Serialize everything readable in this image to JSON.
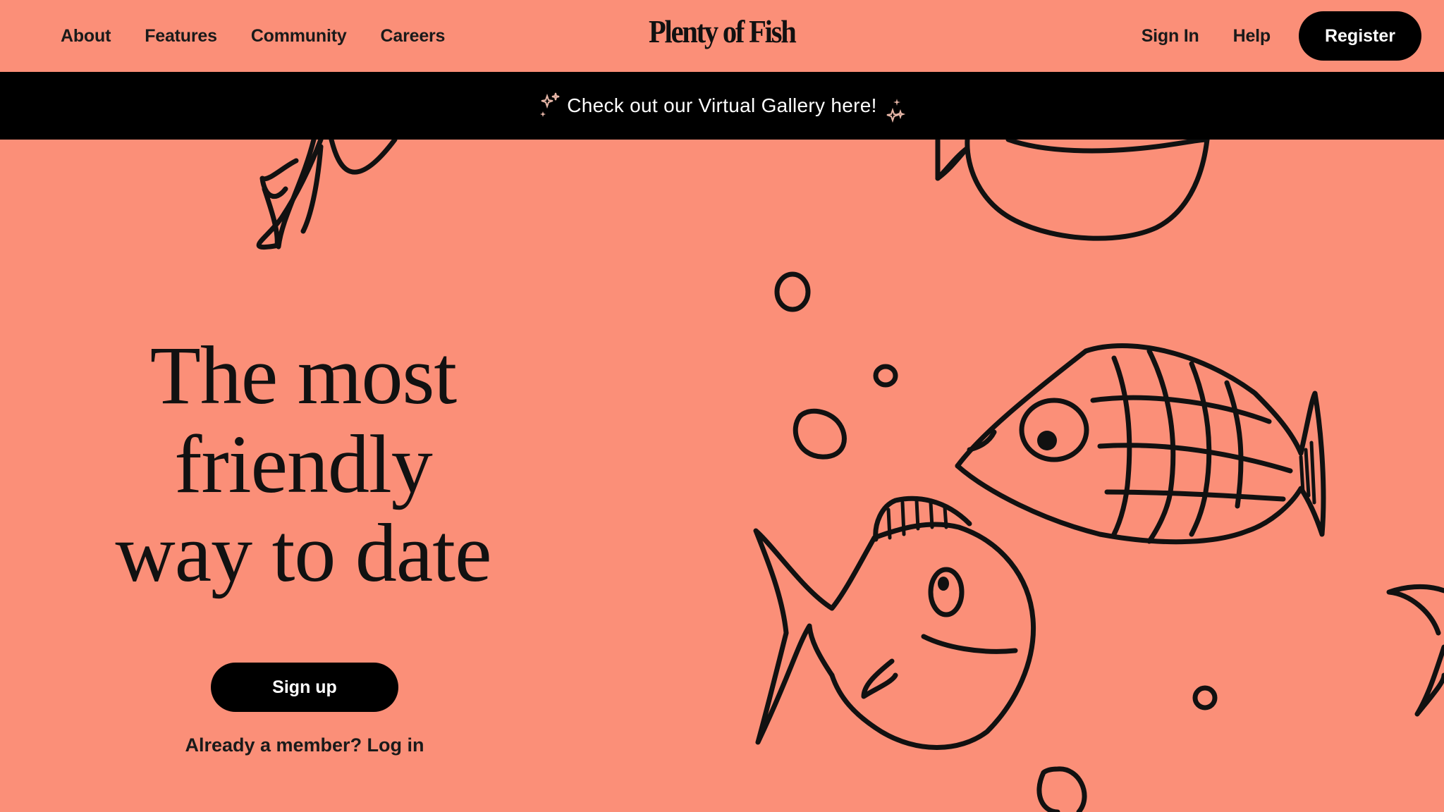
{
  "header": {
    "nav_left": [
      "About",
      "Features",
      "Community",
      "Careers"
    ],
    "logo": "Plenty of Fish",
    "sign_in": "Sign In",
    "help": "Help",
    "register": "Register"
  },
  "banner": {
    "text": "Check out our Virtual Gallery here!",
    "icon_left": "sparkle-icon",
    "icon_right": "sparkle-icon"
  },
  "hero": {
    "title_lines": [
      "The most",
      "friendly",
      "way to date"
    ],
    "signup_label": "Sign up",
    "login_text": "Already a member? Log in"
  },
  "colors": {
    "background": "#fb8f78",
    "dark": "#000000",
    "button_text": "#ffffff"
  }
}
